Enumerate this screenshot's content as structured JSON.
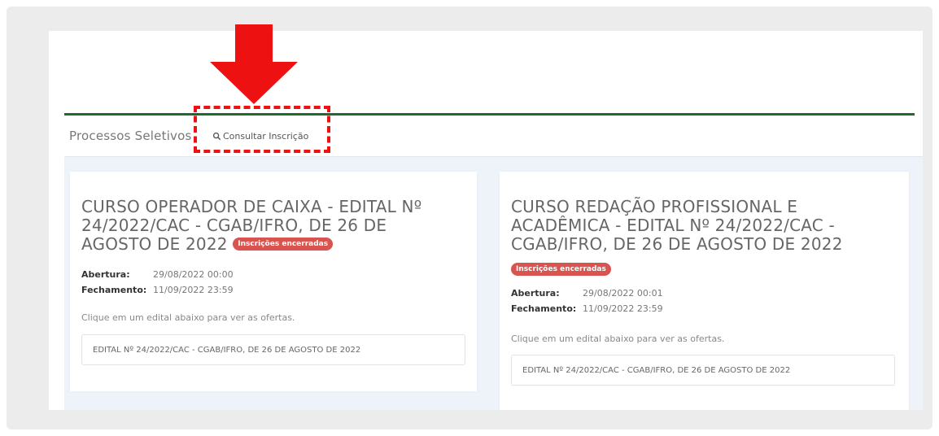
{
  "nav": {
    "title": "Processos Seletivos",
    "consultar_label": "Consultar Inscrição",
    "consultar_icon": "search-icon"
  },
  "cards": [
    {
      "title": "CURSO OPERADOR DE CAIXA - EDITAL Nº 24/2022/CAC - CGAB/IFRO, DE 26 DE AGOSTO DE 2022",
      "status": "Inscrições encerradas",
      "abertura_label": "Abertura:",
      "abertura": "29/08/2022 00:00",
      "fechamento_label": "Fechamento:",
      "fechamento": "11/09/2022 23:59",
      "hint": "Clique em um edital abaixo para ver as ofertas.",
      "edital": "EDITAL Nº 24/2022/CAC - CGAB/IFRO, DE 26 DE AGOSTO DE 2022"
    },
    {
      "title": "CURSO REDAÇÃO PROFISSIONAL E ACADÊMICA - EDITAL Nº 24/2022/CAC - CGAB/IFRO, DE 26 DE AGOSTO DE 2022",
      "status": "Inscrições encerradas",
      "abertura_label": "Abertura:",
      "abertura": "29/08/2022 00:01",
      "fechamento_label": "Fechamento:",
      "fechamento": "11/09/2022 23:59",
      "hint": "Clique em um edital abaixo para ver as ofertas.",
      "edital": "EDITAL Nº 24/2022/CAC - CGAB/IFRO, DE 26 DE AGOSTO DE 2022"
    }
  ],
  "colors": {
    "accent_green": "#1f6b2b",
    "badge_red": "#d9534f",
    "annotation_red": "#ee1111"
  },
  "annotation": {
    "arrow_icon": "arrow-down-icon"
  }
}
